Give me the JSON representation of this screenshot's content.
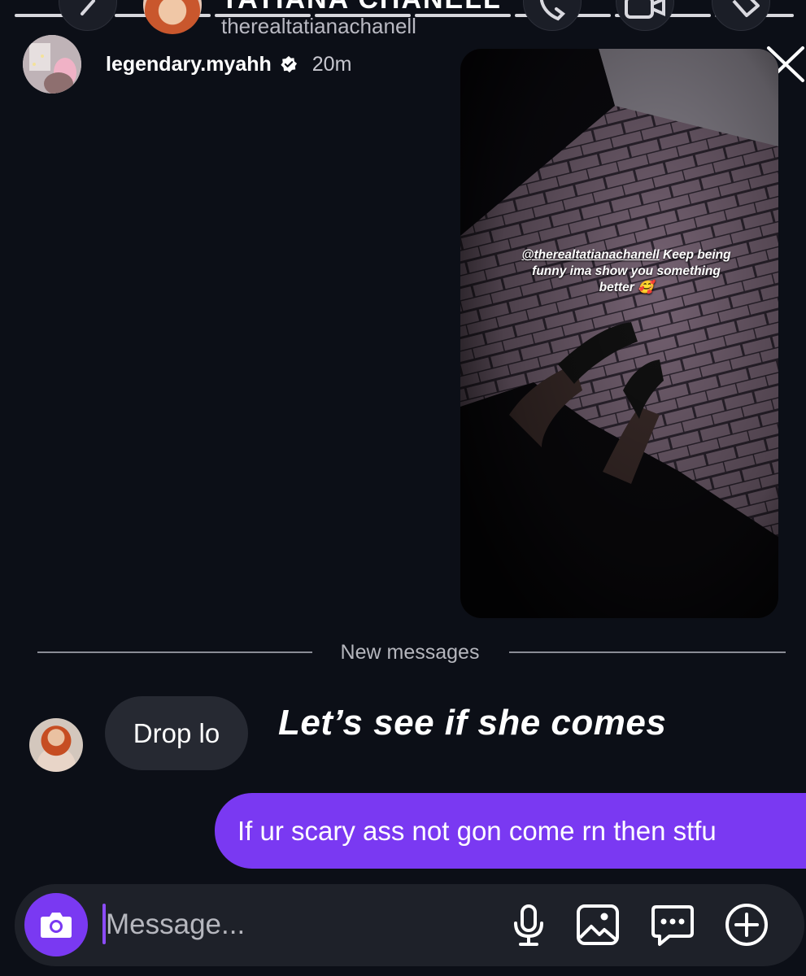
{
  "header": {
    "title": "TATIANA CHANELL",
    "username": "therealtatianachanell",
    "icons": [
      "back-icon",
      "phone-icon",
      "video-call-icon",
      "tag-icon"
    ]
  },
  "story_reply": {
    "username": "legendary.myahh",
    "time": "20m",
    "verified": true,
    "caption_mention": "@therealtatianachanell",
    "caption_text": " Keep being funny ima show you something better 🥰"
  },
  "divider": {
    "label": "New messages"
  },
  "messages": {
    "incoming": "Drop lo",
    "overlay_caption": "Let’s see if she comes",
    "outgoing": "If ur scary ass not gon come rn then stfu"
  },
  "composer": {
    "placeholder": "Message...",
    "icons": [
      "camera-icon",
      "microphone-icon",
      "gallery-icon",
      "sticker-icon",
      "plus-icon"
    ]
  },
  "colors": {
    "background": "#0c0f17",
    "accent": "#7a39f2",
    "bubble_incoming": "#262932",
    "composer_bg": "#1e2129"
  }
}
